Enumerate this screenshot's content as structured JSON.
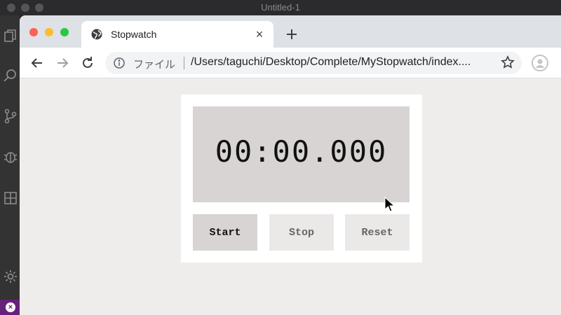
{
  "editor": {
    "window_title": "Untitled-1"
  },
  "browser": {
    "tab": {
      "title": "Stopwatch",
      "favicon": "globe-icon",
      "close_glyph": "×"
    },
    "toolbar": {
      "back_icon": "back-arrow-icon",
      "forward_icon": "forward-arrow-icon",
      "reload_icon": "reload-icon",
      "address_label": "ファイル",
      "url": "/Users/taguchi/Desktop/Complete/MyStopwatch/index...."
    }
  },
  "stopwatch": {
    "time": "00:00.000",
    "start_label": "Start",
    "stop_label": "Stop",
    "reset_label": "Reset"
  },
  "colors": {
    "display_bg": "#d8d4d4",
    "page_bg": "#efecec",
    "card_bg": "#ffffff"
  }
}
